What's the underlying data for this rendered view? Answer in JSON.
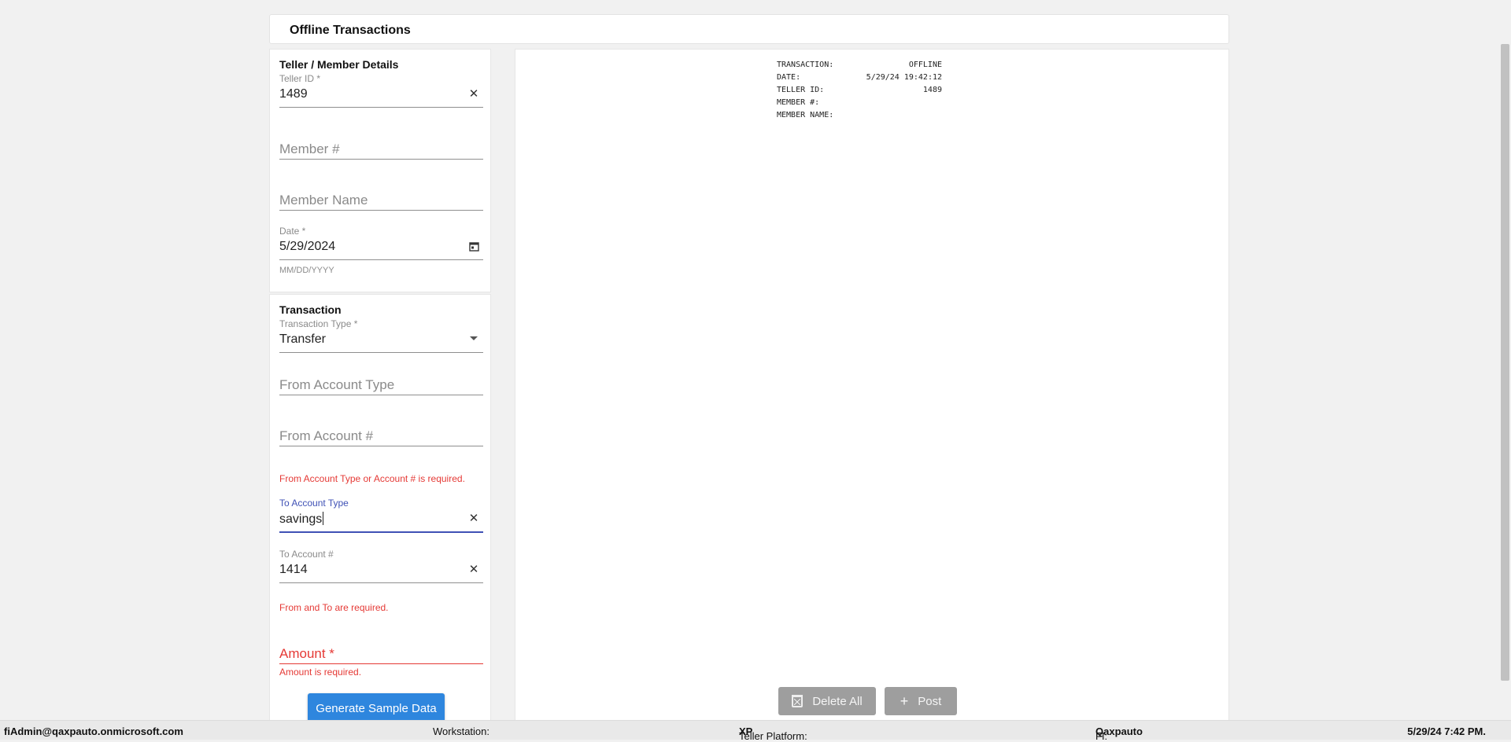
{
  "header": {
    "title": "Offline Transactions"
  },
  "teller_section": {
    "title": "Teller / Member Details",
    "teller_id": {
      "label": "Teller ID *",
      "value": "1489"
    },
    "member_number": {
      "placeholder": "Member #"
    },
    "member_name": {
      "placeholder": "Member Name"
    },
    "date": {
      "label": "Date *",
      "value": "5/29/2024",
      "hint": "MM/DD/YYYY"
    }
  },
  "transaction_section": {
    "title": "Transaction",
    "transaction_type": {
      "label": "Transaction Type *",
      "value": "Transfer"
    },
    "from_account_type": {
      "placeholder": "From Account Type"
    },
    "from_account_number": {
      "placeholder": "From Account #"
    },
    "from_error": "From Account Type or Account # is required.",
    "to_account_type": {
      "label": "To Account Type",
      "value": "savings"
    },
    "to_account_number": {
      "label": "To Account #",
      "value": "1414"
    },
    "to_error": "From and To are required.",
    "amount": {
      "placeholder": "Amount *",
      "error": "Amount is required."
    },
    "generate_button": "Generate Sample Data"
  },
  "receipt": {
    "rows": [
      {
        "label": "TRANSACTION:",
        "value": "OFFLINE"
      },
      {
        "label": "DATE:",
        "value": "5/29/24 19:42:12"
      },
      {
        "label": "TELLER ID:",
        "value": "1489"
      },
      {
        "label": "MEMBER #:",
        "value": ""
      },
      {
        "label": "MEMBER NAME:",
        "value": ""
      }
    ],
    "delete_all_label": "Delete All",
    "post_label": "Post"
  },
  "footer": {
    "user": "fiAdmin@qaxpauto.onmicrosoft.com",
    "workstation_label": "Workstation:",
    "platform_label": "Teller Platform:",
    "platform_value": "XP",
    "fi_label": "FI:",
    "fi_value": "Qaxpauto",
    "datetime": "5/29/24 7:42 PM."
  },
  "icons": {
    "clear": "close-icon",
    "calendar": "calendar-icon",
    "dropdown": "chevron-down-icon",
    "delete": "trash-icon",
    "add": "plus-icon"
  },
  "colors": {
    "primary_button": "#2e86de",
    "error": "#e53935",
    "focus": "#3f51b5",
    "disabled_button": "#9e9e9e"
  }
}
